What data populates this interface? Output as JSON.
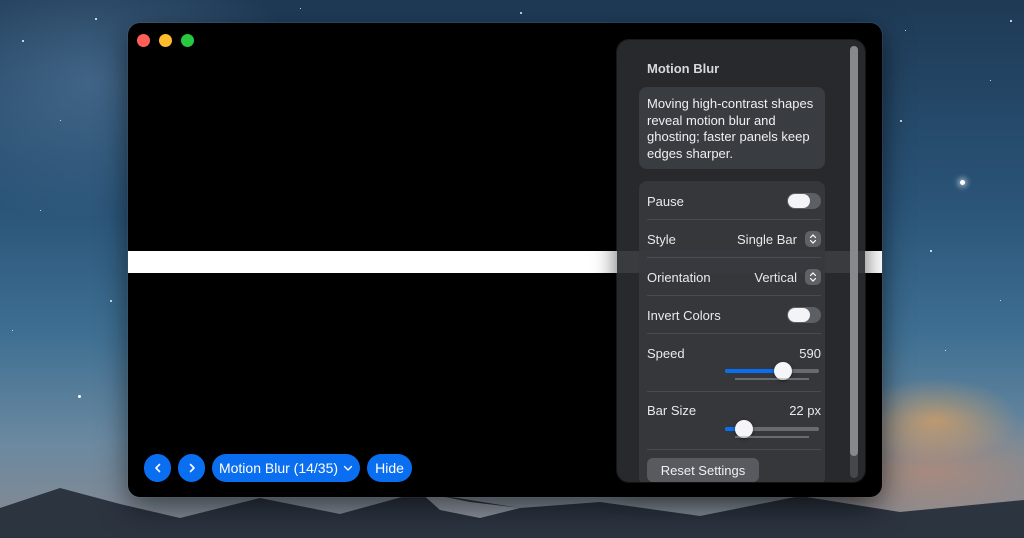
{
  "window": {
    "controls": [
      "close",
      "minimize",
      "maximize"
    ]
  },
  "bottom_bar": {
    "prev_icon": "chevron-left-icon",
    "next_icon": "chevron-right-icon",
    "demo_select_label": "Motion Blur (14/35)",
    "hide_label": "Hide"
  },
  "panel": {
    "title": "Motion Blur",
    "description": "Moving high-contrast shapes reveal motion blur and ghosting; faster panels keep edges sharper.",
    "settings": {
      "pause": {
        "label": "Pause",
        "on": false
      },
      "style": {
        "label": "Style",
        "value": "Single Bar"
      },
      "orientation": {
        "label": "Orientation",
        "value": "Vertical"
      },
      "invert_colors": {
        "label": "Invert Colors",
        "on": false
      },
      "speed": {
        "label": "Speed",
        "value": "590",
        "fraction": 0.62
      },
      "bar_size": {
        "label": "Bar Size",
        "value": "22 px",
        "fraction": 0.2
      }
    },
    "reset_label": "Reset Settings"
  },
  "colors": {
    "accent": "#0a6ef0",
    "window_bg": "#000000",
    "bar": "#ffffff"
  }
}
